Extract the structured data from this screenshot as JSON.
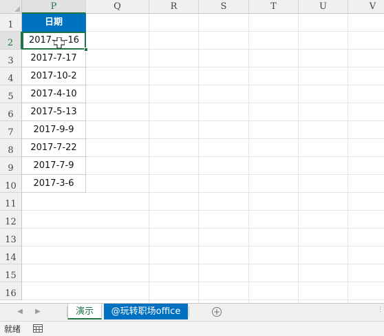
{
  "sheet": {
    "columns": [
      "P",
      "Q",
      "R",
      "S",
      "T",
      "U",
      "V"
    ],
    "selected_column": "P",
    "rows": [
      "1",
      "2",
      "3",
      "4",
      "5",
      "6",
      "7",
      "8",
      "9",
      "10",
      "11",
      "12",
      "13",
      "14",
      "15",
      "16"
    ],
    "selected_row": "2",
    "header_cell": "日期",
    "dates": [
      "2017-11-16",
      "2017-7-17",
      "2017-10-2",
      "2017-4-10",
      "2017-5-13",
      "2017-9-9",
      "2017-7-22",
      "2017-7-9",
      "2017-3-6"
    ],
    "active_cell_display": "2017-",
    "active_cell_tail": "-16",
    "header_fill_color": "#0070c0",
    "selection_color": "#217346"
  },
  "tabs": {
    "items": [
      {
        "label": "演示",
        "active": true
      },
      {
        "label": "@玩转职场office",
        "active": false
      }
    ],
    "add_icon": "plus-circle-icon",
    "nav_prev_icon": "triangle-left-icon",
    "nav_next_icon": "triangle-right-icon"
  },
  "status": {
    "text": "就绪",
    "icon": "macro-record-icon"
  }
}
